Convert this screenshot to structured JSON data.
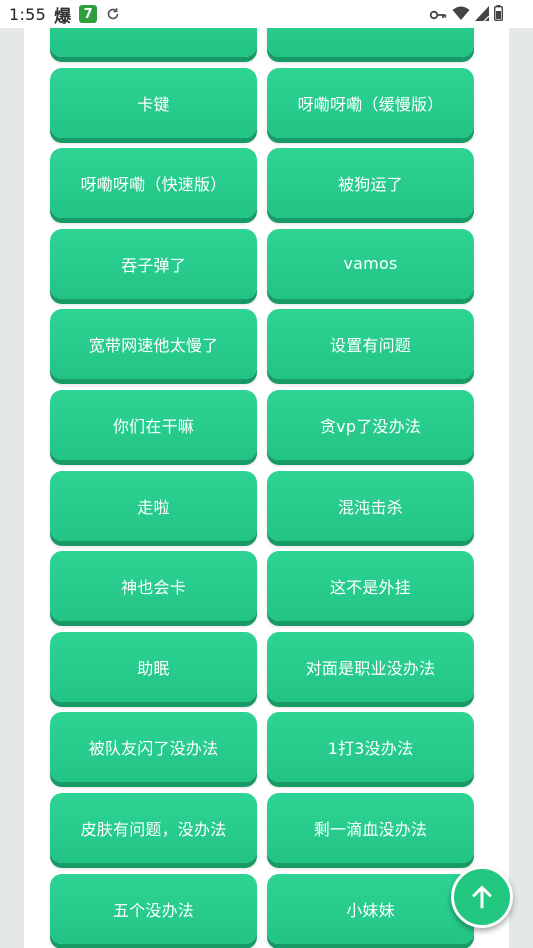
{
  "status_bar": {
    "time": "1:55",
    "glyph": "爆",
    "badge": "7",
    "icons": [
      "sync-icon",
      "key-icon",
      "wifi-icon",
      "signal-icon",
      "battery-icon"
    ]
  },
  "buttons": [
    "",
    "",
    "卡键",
    "呀嘞呀嘞（缓慢版）",
    "呀嘞呀嘞（快速版）",
    "被狗运了",
    "吞子弹了",
    "vamos",
    "宽带网速他太慢了",
    "设置有问题",
    "你们在干嘛",
    "贪vp了没办法",
    "走啦",
    "混沌击杀",
    "神也会卡",
    "这不是外挂",
    "助眠",
    "对面是职业没办法",
    "被队友闪了没办法",
    "1打3没办法",
    "皮肤有问题，没办法",
    "剩一滴血没办法",
    "五个没办法",
    "小妹妹"
  ],
  "colors": {
    "button": "#22c485",
    "button_shadow": "#179a66",
    "fab": "#22c87f",
    "background": "#ffffff"
  },
  "fab_icon": "arrow-up-icon"
}
